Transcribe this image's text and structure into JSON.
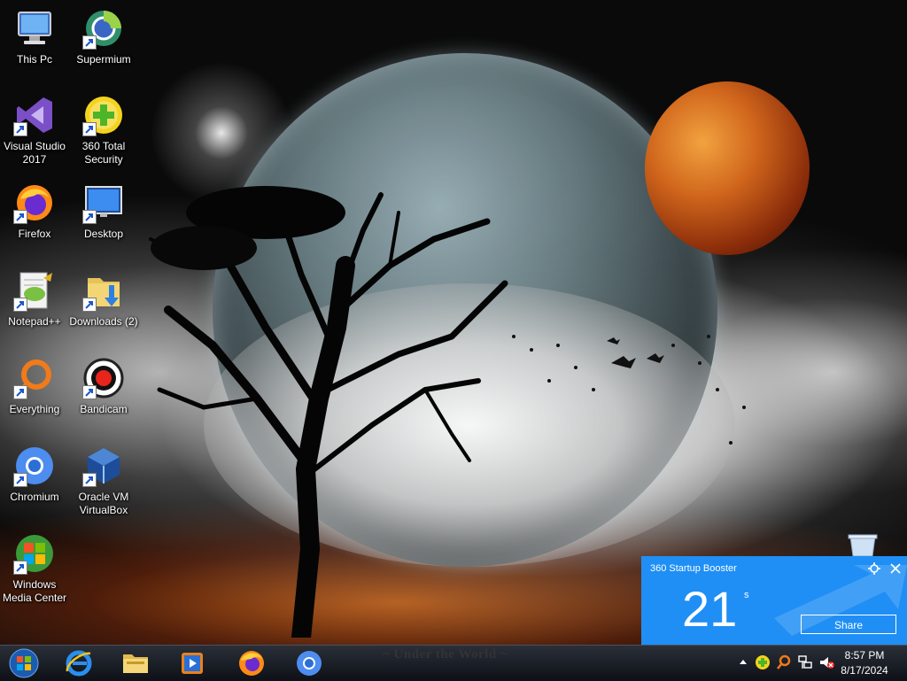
{
  "desktop": {
    "wallpaper_caption": "~ Under the World ~",
    "icons": [
      {
        "id": "this-pc",
        "label": "This Pc",
        "icon": "computer-icon",
        "shortcut": false
      },
      {
        "id": "supermium",
        "label": "Supermium",
        "icon": "supermium-icon",
        "shortcut": true
      },
      {
        "id": "visual-studio",
        "label": "Visual Studio 2017",
        "icon": "visual-studio-icon",
        "shortcut": true
      },
      {
        "id": "360-total-security",
        "label": "360 Total Security",
        "icon": "360-security-icon",
        "shortcut": true
      },
      {
        "id": "firefox",
        "label": "Firefox",
        "icon": "firefox-icon",
        "shortcut": true
      },
      {
        "id": "desktop",
        "label": "Desktop",
        "icon": "desktop-monitor-icon",
        "shortcut": true
      },
      {
        "id": "notepad-plus",
        "label": "Notepad++",
        "icon": "notepad-plus-icon",
        "shortcut": true
      },
      {
        "id": "downloads",
        "label": "Downloads (2)",
        "icon": "downloads-folder-icon",
        "shortcut": true
      },
      {
        "id": "everything",
        "label": "Everything",
        "icon": "everything-search-icon",
        "shortcut": true
      },
      {
        "id": "bandicam",
        "label": "Bandicam",
        "icon": "bandicam-icon",
        "shortcut": true
      },
      {
        "id": "chromium",
        "label": "Chromium",
        "icon": "chromium-icon",
        "shortcut": true
      },
      {
        "id": "virtualbox",
        "label": "Oracle VM VirtualBox",
        "icon": "virtualbox-icon",
        "shortcut": true
      },
      {
        "id": "windows-media-center",
        "label": "Windows Media Center",
        "icon": "windows-media-center-icon",
        "shortcut": true
      }
    ],
    "recycle_bin": {
      "icon": "recycle-bin-icon"
    }
  },
  "taskbar": {
    "start": {
      "icon": "windows-start-icon"
    },
    "pinned": [
      {
        "id": "ie",
        "icon": "internet-explorer-icon"
      },
      {
        "id": "explorer",
        "icon": "file-explorer-icon"
      },
      {
        "id": "media-player",
        "icon": "media-player-icon"
      },
      {
        "id": "firefox",
        "icon": "firefox-icon"
      },
      {
        "id": "chromium",
        "icon": "chromium-icon"
      }
    ],
    "tray": {
      "icons": [
        "show-hidden-icons-icon",
        "360-security-tray-icon",
        "search-tray-icon",
        "network-icon",
        "volume-muted-icon"
      ],
      "time": "8:57 PM",
      "date": "8/17/2024"
    }
  },
  "popup": {
    "title": "360 Startup Booster",
    "value": "21",
    "unit": "s",
    "share_label": "Share",
    "color": "#1f8ff5"
  }
}
